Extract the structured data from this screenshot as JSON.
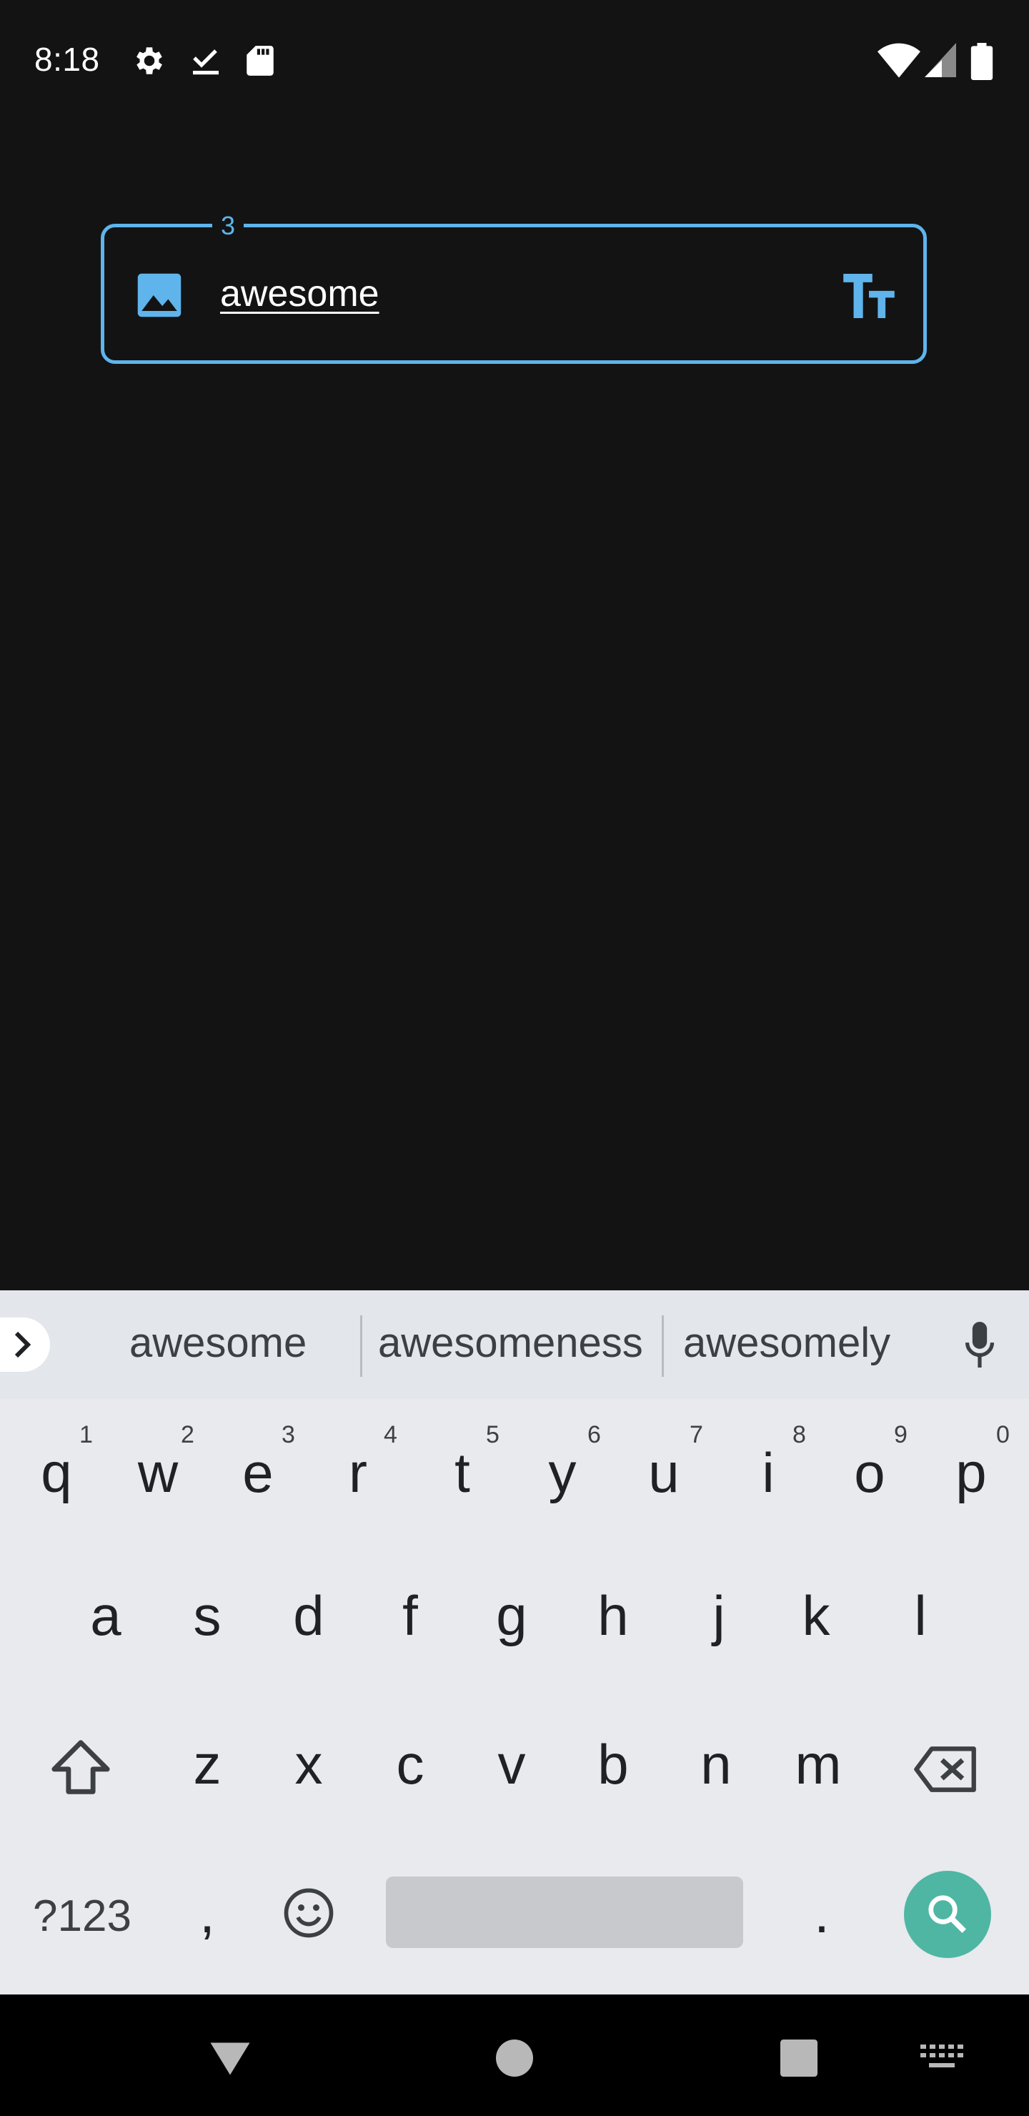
{
  "status_bar": {
    "time": "8:18",
    "left_icons": [
      "gear-icon",
      "checkmark-download-icon",
      "sd-card-icon"
    ],
    "right_icons": [
      "wifi-icon",
      "signal-icon",
      "battery-icon"
    ]
  },
  "search_field": {
    "count_label": "3",
    "value": "awesome",
    "left_icon": "image-icon",
    "right_icon": "text-size-icon",
    "accent_color": "#5fb4ec"
  },
  "keyboard": {
    "suggestions": [
      "awesome",
      "awesomeness",
      "awesomely"
    ],
    "row1": [
      {
        "key": "q",
        "hint": "1"
      },
      {
        "key": "w",
        "hint": "2"
      },
      {
        "key": "e",
        "hint": "3"
      },
      {
        "key": "r",
        "hint": "4"
      },
      {
        "key": "t",
        "hint": "5"
      },
      {
        "key": "y",
        "hint": "6"
      },
      {
        "key": "u",
        "hint": "7"
      },
      {
        "key": "i",
        "hint": "8"
      },
      {
        "key": "o",
        "hint": "9"
      },
      {
        "key": "p",
        "hint": "0"
      }
    ],
    "row2": [
      "a",
      "s",
      "d",
      "f",
      "g",
      "h",
      "j",
      "k",
      "l"
    ],
    "row3": [
      "z",
      "x",
      "c",
      "v",
      "b",
      "n",
      "m"
    ],
    "symbols_key": "?123",
    "comma_key": ",",
    "period_key": ".",
    "action_key_color": "#4fb6a4"
  },
  "nav_bar": {
    "buttons": [
      "back-icon",
      "home-icon",
      "recents-icon",
      "keyboard-switch-icon"
    ]
  }
}
